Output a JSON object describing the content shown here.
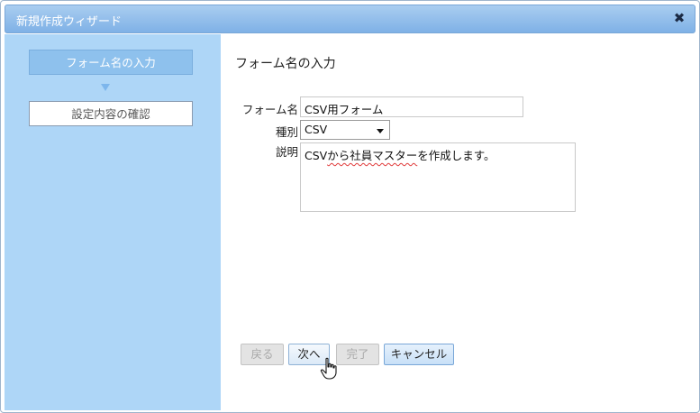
{
  "dialog": {
    "title": "新規作成ウィザード",
    "close_glyph": "✖"
  },
  "sidebar": {
    "steps": [
      {
        "label": "フォーム名の入力",
        "active": true
      },
      {
        "label": "設定内容の確認",
        "active": false
      }
    ]
  },
  "form": {
    "heading": "フォーム名の入力",
    "name_label": "フォーム名",
    "name_value": "CSV用フォーム",
    "type_label": "種別",
    "type_value": "CSV",
    "description_label": "説明",
    "description_prefix": "CSV",
    "description_misspelled": "から社員マスター",
    "description_suffix": "を作成します。"
  },
  "buttons": {
    "back": "戻る",
    "next": "次へ",
    "finish": "完了",
    "cancel": "キャンセル"
  },
  "colors": {
    "sidebar_bg": "#aed6f7",
    "active_step_bg": "#8ec1ed",
    "titlebar_bg": "#7fb1e6"
  }
}
